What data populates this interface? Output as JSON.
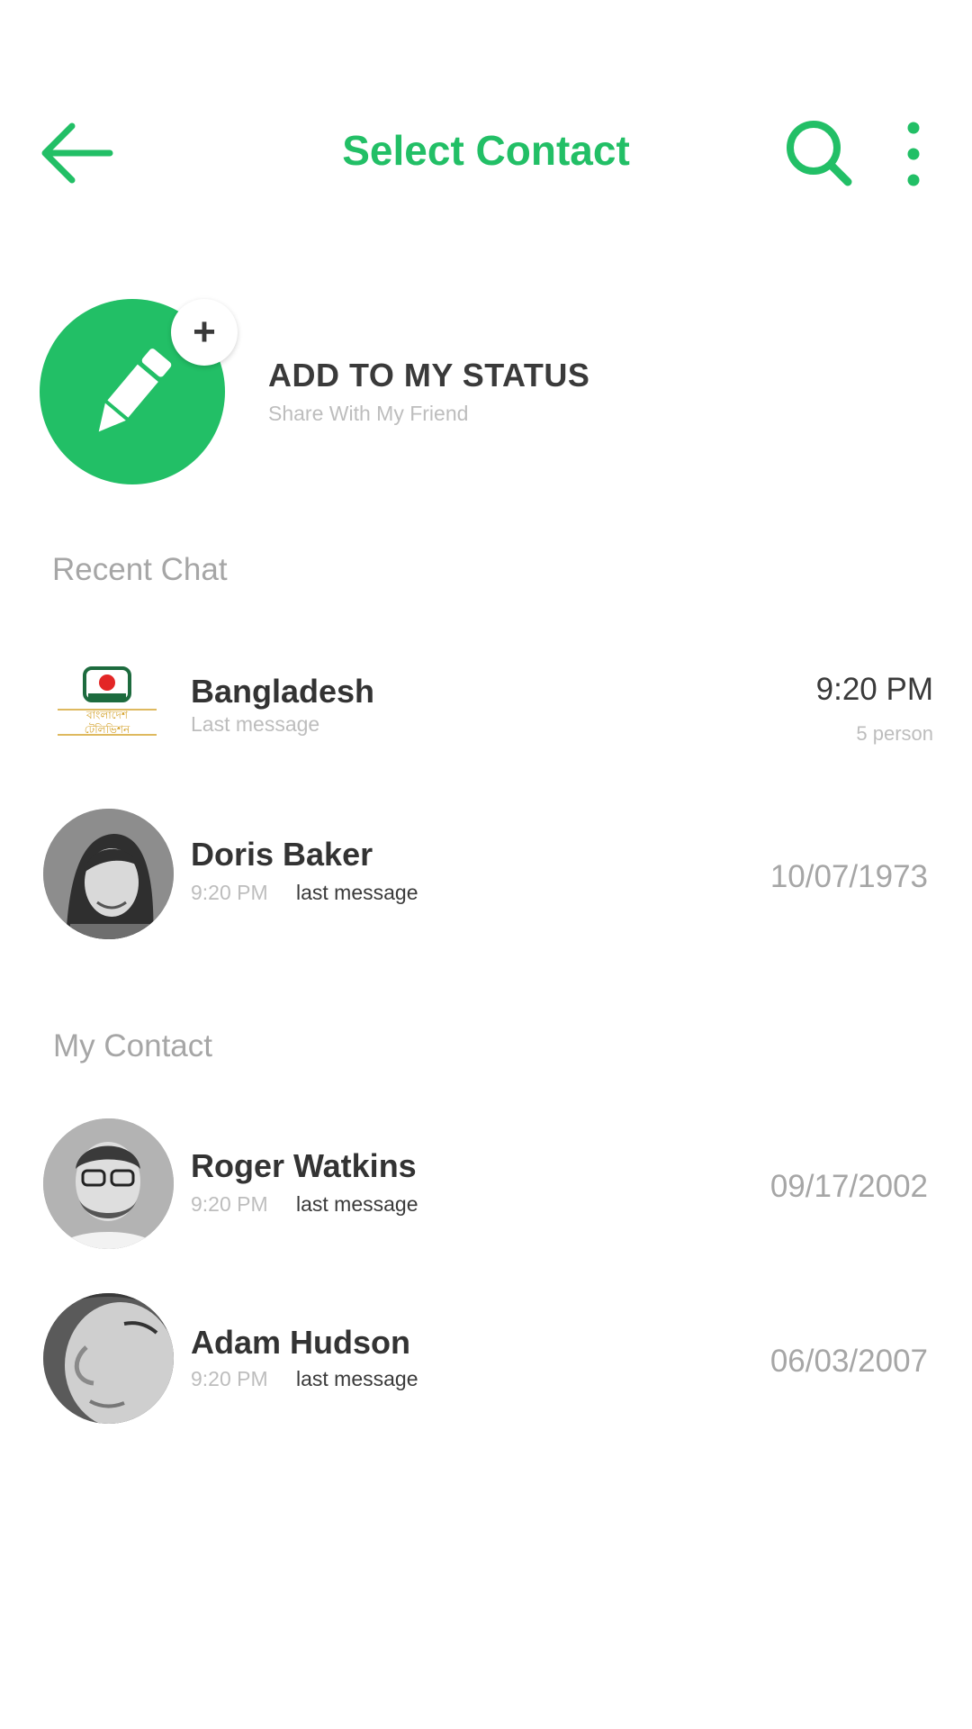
{
  "header": {
    "title": "Select Contact",
    "back_icon": "arrow-left-icon",
    "search_icon": "search-icon",
    "more_icon": "more-vertical-icon",
    "accent_color": "#22bf66"
  },
  "status": {
    "title": "ADD TO MY STATUS",
    "subtitle": "Share With My Friend",
    "badge": "+",
    "icon": "pencil-icon"
  },
  "sections": {
    "recent": "Recent Chat",
    "contacts": "My Contact"
  },
  "recent_chats": [
    {
      "name": "Bangladesh",
      "subtitle": "Last message",
      "time": "9:20 PM",
      "members": "5 person",
      "logo_text_line1": "বাংলাদেশ",
      "logo_text_line2": "টেলিভিশন"
    },
    {
      "name": "Doris Baker",
      "time": "9:20 PM",
      "message": "last message",
      "date": "10/07/1973"
    }
  ],
  "contacts": [
    {
      "name": "Roger Watkins",
      "time": "9:20 PM",
      "message": "last message",
      "date": "09/17/2002"
    },
    {
      "name": "Adam Hudson",
      "time": "9:20 PM",
      "message": "last message",
      "date": "06/03/2007"
    }
  ]
}
